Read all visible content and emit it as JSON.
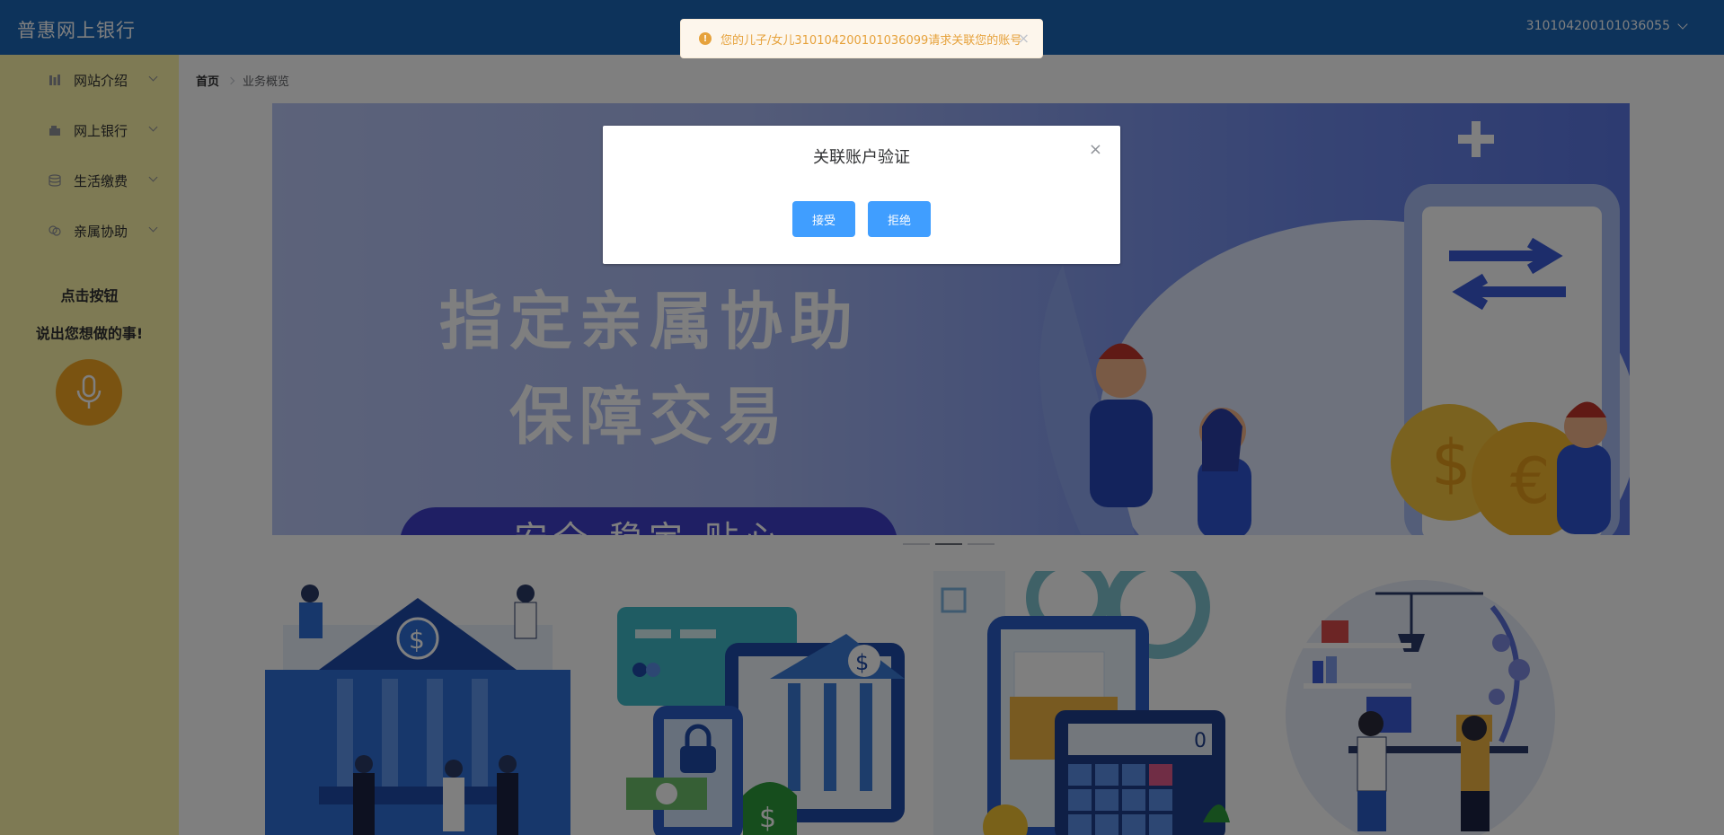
{
  "header": {
    "brand": "普惠网上银行",
    "account": "310104200101036055"
  },
  "sidebar": {
    "items": [
      {
        "label": "网站介绍",
        "icon": "building-icon"
      },
      {
        "label": "网上银行",
        "icon": "bank-card-icon"
      },
      {
        "label": "生活缴费",
        "icon": "coins-icon"
      },
      {
        "label": "亲属协助",
        "icon": "chat-icon"
      }
    ],
    "voice_title_1": "点击按钮",
    "voice_title_2": "说出您想做的事!",
    "mic_icon": "microphone-icon"
  },
  "breadcrumb": {
    "home": "首页",
    "current": "业务概览"
  },
  "banner": {
    "line1": "指定亲属协助",
    "line2": "保障交易",
    "pill": "· 安全  稳定  贴心 ·"
  },
  "toast": {
    "text": "您的儿子/女儿310104200101036099请求关联您的账号"
  },
  "dialog": {
    "title": "关联账户验证",
    "accept": "接受",
    "reject": "拒绝"
  },
  "colors": {
    "header": "#1a66b6",
    "sidebar": "#fdf5a8",
    "mic": "#f5a623",
    "primary_button": "#409eff",
    "warning": "#e6a23c"
  }
}
